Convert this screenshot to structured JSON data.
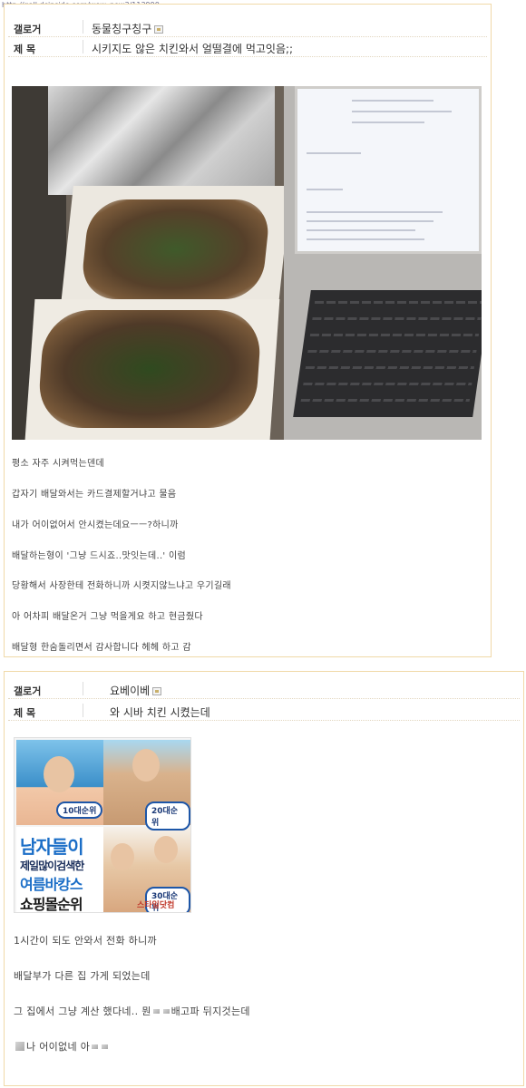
{
  "url": "http://gall.dcinside.com/wow_new3/113990",
  "posts": [
    {
      "label_gallerist": "갤로거",
      "author": "동물칭구칭구",
      "label_subject": "제 목",
      "subject": "시키지도 않은 치킨와서 얼떨결에 먹고잇음;;",
      "lines": [
        "평소 자주 시켜먹는덴데",
        "갑자기 배달와서는 카드결제할거냐고 물음",
        "내가 어이없어서 안시켰는데요ㅡㅡ?하니까",
        "배달하는형이 '그냥 드시죠..맛잇는데..' 이럼",
        "당황해서 사장한테 전화하니까 시켯지않느냐고 우기길래",
        "아 어차피 배달온거 그냥 먹을게요 하고 현금줬다",
        "배달형 한숨돌리면서 감사합니다 헤헤 하고 감"
      ]
    },
    {
      "label_gallerist": "갤로거",
      "author": "요베이베",
      "label_subject": "제 목",
      "subject": "와 시바 치킨 시켰는데",
      "banner": {
        "line1": "남자들이",
        "line2": "제일많이검색한",
        "line3": "여름바캉스",
        "line4": "쇼핑몰순위",
        "rank1": "10대순위",
        "rank2": "20대순위",
        "rank3": "30대순위",
        "shop": "스타일닷컴"
      },
      "lines": [
        "1시간이 되도 안와서 전화 하니까",
        "배달부가 다른 집 가게 되었는데",
        "그 집에서 그냥 계산 했다네.. 뭔",
        "배고파 뒤지것는데",
        "나 어이없네 아"
      ]
    }
  ]
}
